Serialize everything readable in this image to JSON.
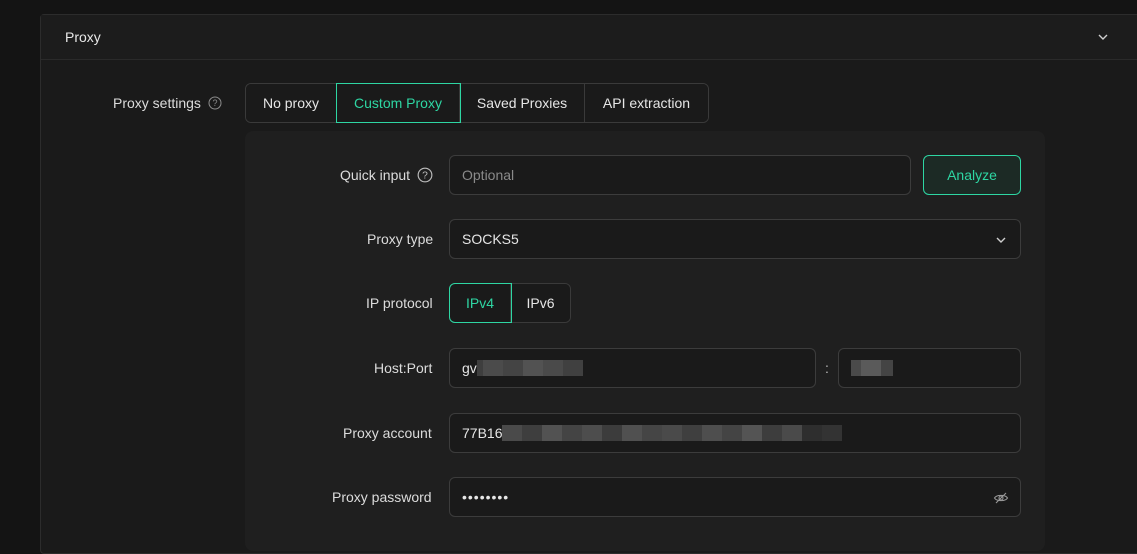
{
  "panel": {
    "title": "Proxy"
  },
  "proxy_settings": {
    "label": "Proxy settings",
    "tabs": [
      {
        "label": "No proxy",
        "active": false
      },
      {
        "label": "Custom Proxy",
        "active": true
      },
      {
        "label": "Saved Proxies",
        "active": false
      },
      {
        "label": "API extraction",
        "active": false
      }
    ]
  },
  "quick_input": {
    "label": "Quick input",
    "placeholder": "Optional",
    "button": "Analyze"
  },
  "proxy_type": {
    "label": "Proxy type",
    "value": "SOCKS5"
  },
  "ip_protocol": {
    "label": "IP protocol",
    "options": [
      {
        "label": "IPv4",
        "active": true
      },
      {
        "label": "IPv6",
        "active": false
      }
    ]
  },
  "host_port": {
    "label": "Host:Port",
    "host_prefix": "gv",
    "separator": ":"
  },
  "proxy_account": {
    "label": "Proxy account",
    "value_prefix": "77B16"
  },
  "proxy_password": {
    "label": "Proxy password",
    "masked_value": "••••••••"
  },
  "colors": {
    "accent": "#2ed6a3",
    "background": "#141414",
    "panel": "#1a1a1a",
    "border": "#3c3c3c"
  }
}
